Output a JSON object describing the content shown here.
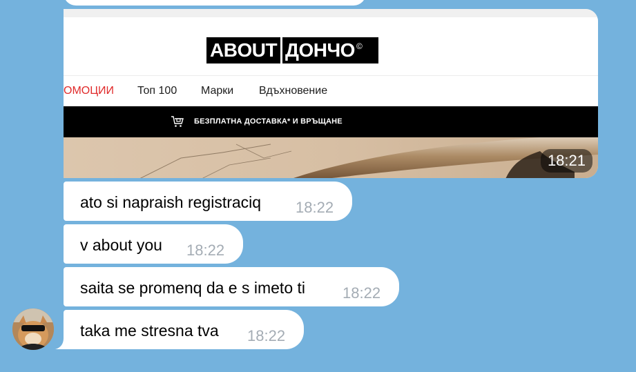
{
  "image_message": {
    "logo": {
      "left": "ABOUT",
      "right": "ДОНЧО",
      "mark": "©"
    },
    "nav": {
      "promo": "ОМОЦИИ",
      "top100": "Топ 100",
      "brands": "Марки",
      "inspiration": "Вдъхновение"
    },
    "banner": {
      "text": "БЕЗПЛАТНА ДОСТАВКА* И ВРЪЩАНЕ",
      "icon": "cart-icon"
    },
    "time": "18:21"
  },
  "messages": [
    {
      "text": "ato si napraish registraciq",
      "time": "18:22"
    },
    {
      "text": "v about you",
      "time": "18:22"
    },
    {
      "text": "saita se promenq da e s imeto ti",
      "time": "18:22"
    },
    {
      "text": "taka me stresna tva",
      "time": "18:22"
    }
  ],
  "colors": {
    "chat_background": "#74b2dd",
    "bubble": "#ffffff",
    "time_text": "#a4acb4",
    "promo_red": "#e02a2a"
  }
}
